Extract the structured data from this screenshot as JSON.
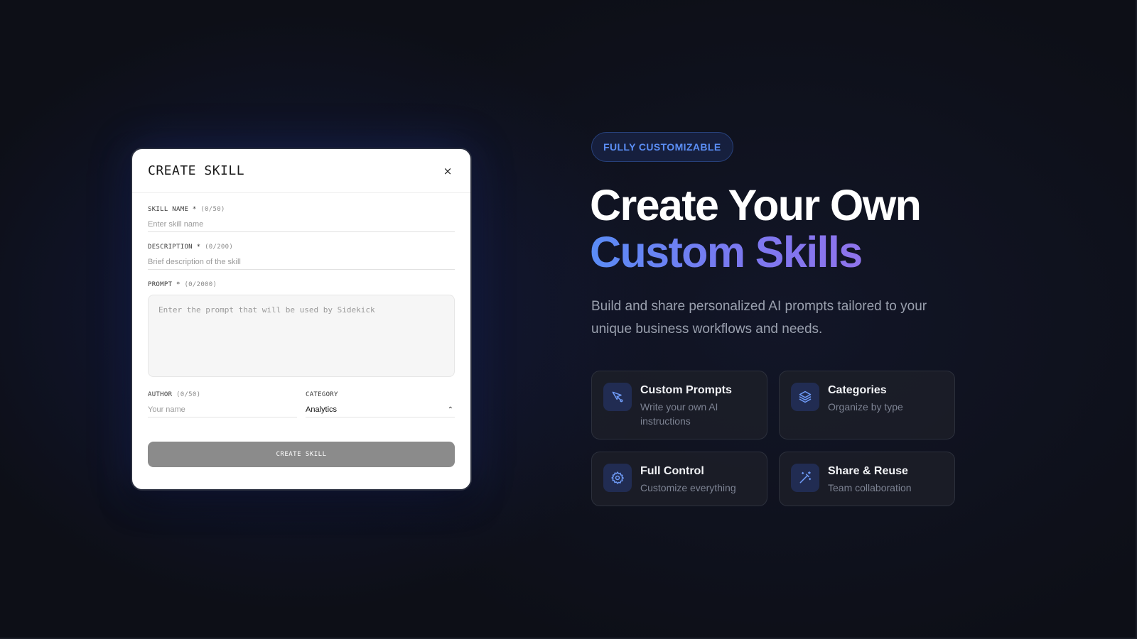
{
  "modal": {
    "title": "CREATE SKILL",
    "close_label": "×",
    "fields": {
      "skill_name": {
        "label": "SKILL NAME *",
        "counter": "(0/50)",
        "placeholder": "Enter skill name",
        "value": ""
      },
      "description": {
        "label": "DESCRIPTION *",
        "counter": "(0/200)",
        "placeholder": "Brief description of the skill",
        "value": ""
      },
      "prompt": {
        "label": "PROMPT *",
        "counter": "(0/2000)",
        "placeholder": "Enter the prompt that will be used by Sidekick",
        "value": ""
      },
      "author": {
        "label": "AUTHOR",
        "counter": "(0/50)",
        "placeholder": "Your name",
        "value": ""
      },
      "category": {
        "label": "CATEGORY",
        "selected": "Analytics",
        "chevron": "⌃"
      }
    },
    "submit_label": "CREATE SKILL"
  },
  "hero": {
    "badge": "FULLY CUSTOMIZABLE",
    "title_line1": "Create Your Own",
    "title_line2": "Custom Skills",
    "subtitle": "Build and share personalized AI prompts tailored to your unique business workflows and needs."
  },
  "features": [
    {
      "icon": "pen-tool-icon",
      "title": "Custom Prompts",
      "desc": "Write your own AI instructions"
    },
    {
      "icon": "layers-icon",
      "title": "Categories",
      "desc": "Organize by type"
    },
    {
      "icon": "gear-icon",
      "title": "Full Control",
      "desc": "Customize everything"
    },
    {
      "icon": "magic-wand-icon",
      "title": "Share & Reuse",
      "desc": "Team collaboration"
    }
  ],
  "colors": {
    "accent_blue": "#5b8ef5",
    "accent_violet": "#8f74ec",
    "background": "#0d0f17",
    "submit_disabled": "#8b8b8b"
  }
}
